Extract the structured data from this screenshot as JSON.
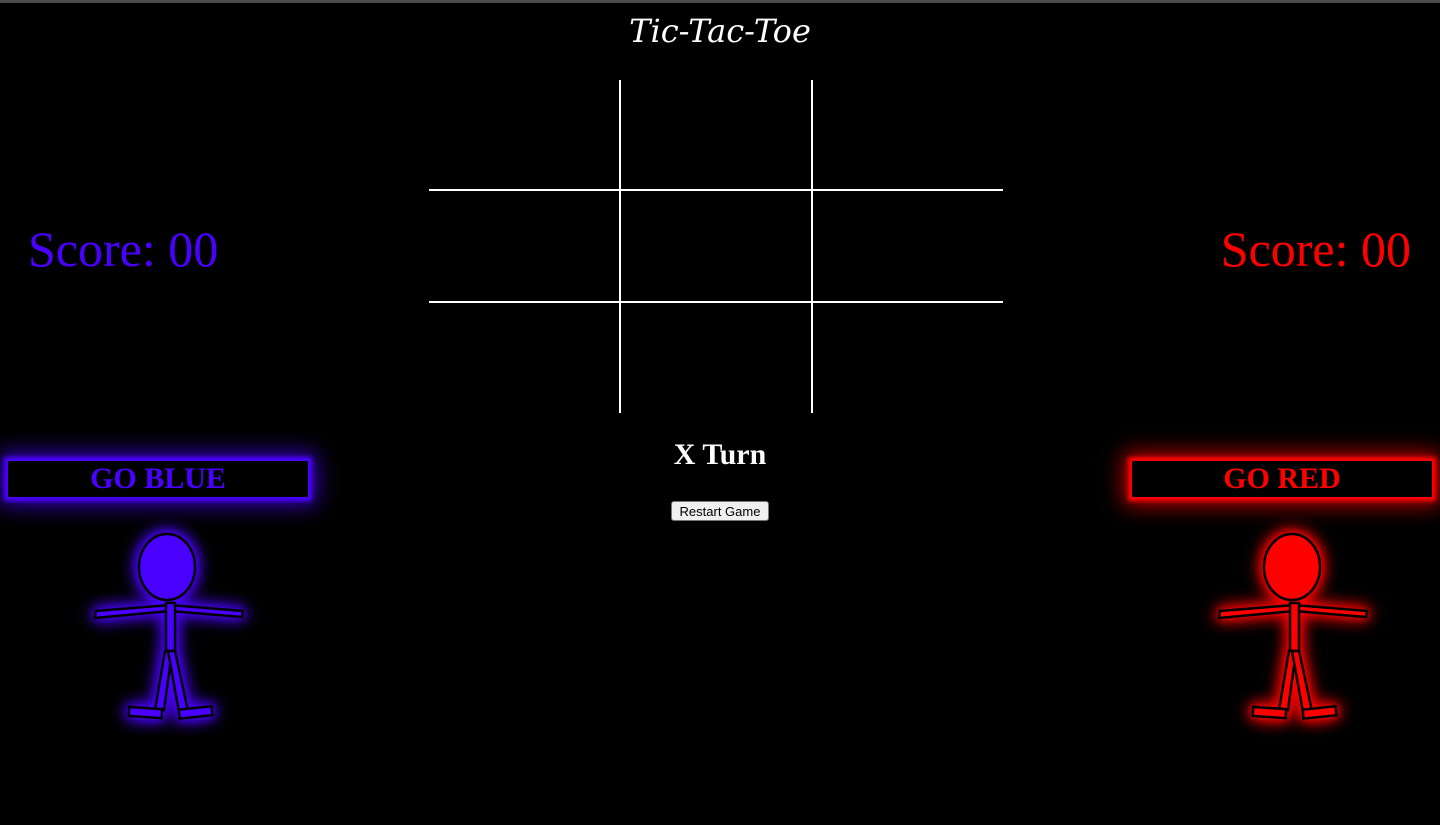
{
  "title": "Tic-Tac-Toe",
  "players": {
    "blue": {
      "score_text": "Score: 00",
      "banner": "GO BLUE",
      "color": "#4a00ff"
    },
    "red": {
      "score_text": "Score: 00",
      "banner": "GO RED",
      "color": "#ff0000"
    }
  },
  "board": {
    "cells": [
      "",
      "",
      "",
      "",
      "",
      "",
      "",
      "",
      ""
    ]
  },
  "status": {
    "turn_text": "X Turn"
  },
  "controls": {
    "restart_label": "Restart Game"
  },
  "icons": {
    "blue_player": "stick-figure-icon",
    "red_player": "stick-figure-icon"
  }
}
